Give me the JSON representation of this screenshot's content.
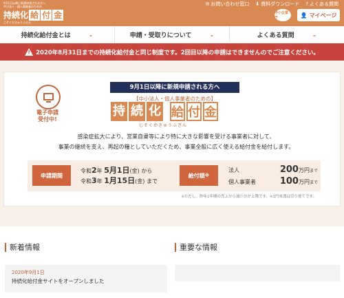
{
  "header": {
    "logo_small_top": "9月1日以降に新規申請される方へ",
    "logo_small_2": "中小法人・個人事業者のための",
    "logo_char1": "持",
    "logo_char2": "続",
    "logo_char3": "化",
    "logo_char4": "給",
    "logo_char5": "付",
    "logo_char6": "金",
    "logo_sub": "じぞくかきゅうふきん",
    "links": [
      {
        "icon": "✉",
        "label": "お問い合わせ窓口"
      },
      {
        "icon": "⬇",
        "label": "資料ダウンロード"
      },
      {
        "icon": "?",
        "label": "よくある質問"
      }
    ],
    "chusho_label": "中小企業庁",
    "mypage_label": "マイページ",
    "mypage_icon": "👤"
  },
  "nav": {
    "items": [
      {
        "label": "持続化給付金とは"
      },
      {
        "label": "申請・受取りについて"
      },
      {
        "label": "よくある質問"
      }
    ],
    "chevron": "⌄"
  },
  "alert": {
    "text": "2020年8月31日までの持続化給付金と同じ制度です。2回目以降の申請はできませんのでご注意ください。",
    "icon": "!"
  },
  "hero": {
    "apply_status_line1": "電子申請",
    "apply_status_line2": "受付中!",
    "banner": "9月1日以降に新規申請される方へ",
    "target": "【中小法人・個人事業者のための】",
    "title_chars": [
      "持",
      "続",
      "化",
      "給",
      "付",
      "金"
    ],
    "ruby": "じぞくかきゅうふきん",
    "description_line1": "感染症拡大により、営業自粛等により特に大きな影響を受ける事業者に対して、",
    "description_line2": "事業の継続を支え、再起の糧としていただくため、事業全般に広く使える給付金を給付します。",
    "period_label": "申請期間",
    "period_start_prefix": "令和",
    "period_start_year": "2",
    "period_start_year_suffix": "年",
    "period_start_date": "5月1日",
    "period_start_day": "(金)",
    "period_start_suffix": "から",
    "period_end_prefix": "令和",
    "period_end_year": "3",
    "period_end_year_suffix": "年",
    "period_end_date": "1月15日",
    "period_end_day": "(金)",
    "period_end_suffix": "まで",
    "amount_label": "給付額",
    "amount_label_mark": "※",
    "corp_label": "法人",
    "corp_amount": "200",
    "corp_unit": "万円",
    "corp_suffix": "まで",
    "indiv_label": "個人事業者",
    "indiv_amount": "100",
    "indiv_unit": "万円",
    "indiv_suffix": "まで",
    "footnote": "※ただし、昨年1年間の売上から減少分が上限です。※1円未満は切り捨てです。"
  },
  "news": {
    "heading": "新着情報",
    "items": [
      {
        "date": "2020年9月1日",
        "text": "持続化給付金サイトをオープンしました"
      }
    ]
  },
  "important": {
    "heading": "重要な情報"
  },
  "colors": {
    "brand_orange": "#d98a52",
    "accent": "#c0653a",
    "alert_red": "#c8443c",
    "navy": "#23305a"
  }
}
